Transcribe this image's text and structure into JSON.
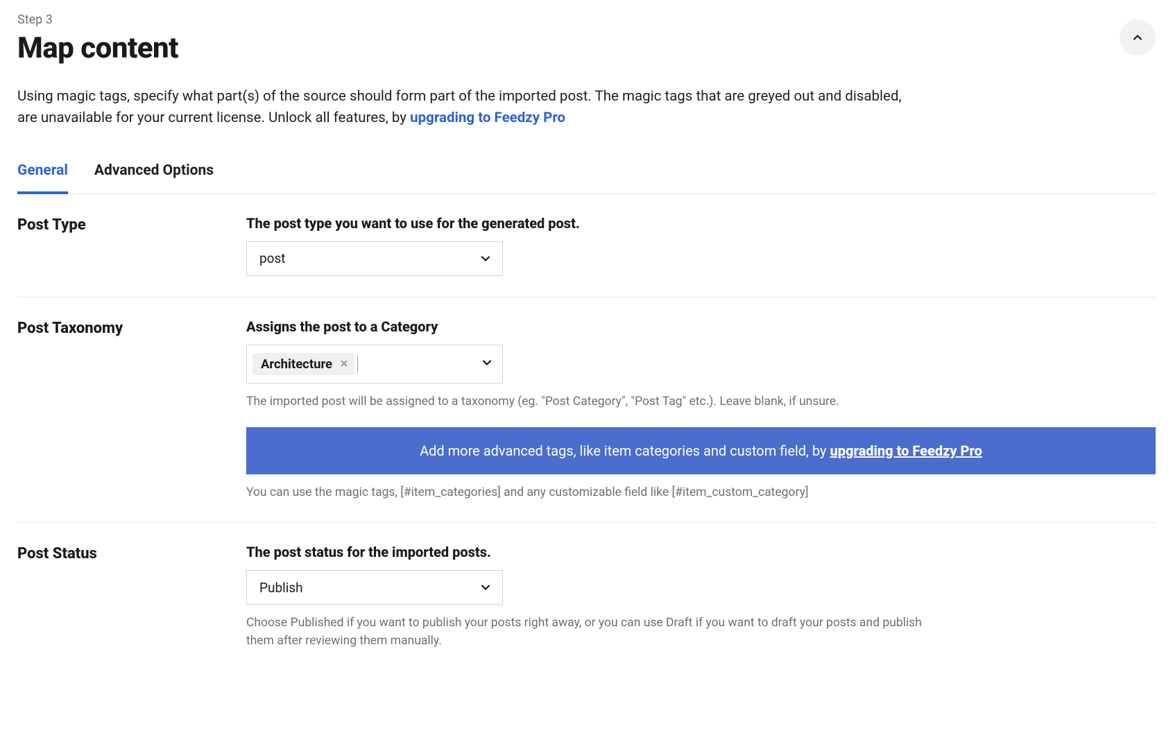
{
  "header": {
    "step": "Step 3",
    "title": "Map content"
  },
  "description": {
    "text_before": "Using magic tags, specify what part(s) of the source should form part of the imported post. The magic tags that are greyed out and disabled, are unavailable for your current license. Unlock all features, by ",
    "upgrade_label": "upgrading to Feedzy Pro"
  },
  "tabs": {
    "general": "General",
    "advanced": "Advanced Options"
  },
  "sections": {
    "post_type": {
      "heading": "Post Type",
      "label": "The post type you want to use for the generated post.",
      "value": "post"
    },
    "post_taxonomy": {
      "heading": "Post Taxonomy",
      "label": "Assigns the post to a Category",
      "chip": "Architecture",
      "help": "The imported post will be assigned to a taxonomy (eg. \"Post Category\", \"Post Tag\" etc.). Leave blank, if unsure.",
      "upsell_before": "Add more advanced tags, like item categories and custom field, by ",
      "upsell_link": "upgrading to Feedzy Pro",
      "magic_help": "You can use the magic tags, [#item_categories] and any customizable field like [#item_custom_category]"
    },
    "post_status": {
      "heading": "Post Status",
      "label": "The post status for the imported posts.",
      "value": "Publish",
      "help": "Choose Published if you want to publish your posts right away, or you can use Draft if you want to draft your posts and publish them after reviewing them manually."
    }
  }
}
